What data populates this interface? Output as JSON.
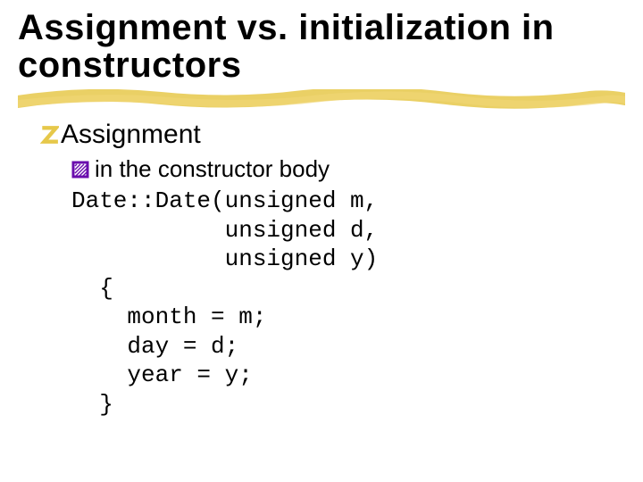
{
  "title": "Assignment vs. initialization in constructors",
  "bullets": {
    "level1": "Assignment",
    "level2": "in the constructor body"
  },
  "code": "Date::Date(unsigned m,\n           unsigned d,\n           unsigned y)\n  {\n    month = m;\n    day = d;\n    year = y;\n  }",
  "colors": {
    "accent_yellow": "#e6c84a",
    "bullet_purple": "#6a0dad"
  }
}
